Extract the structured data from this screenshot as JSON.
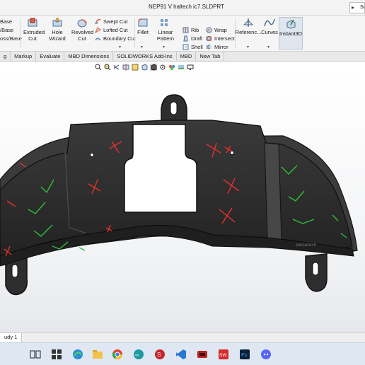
{
  "window": {
    "title": "NEP91 V haltech ic7.SLDPRT",
    "search_text": "Se"
  },
  "ribbon": {
    "left_items": [
      "Base",
      "/Base",
      "oss/Base"
    ],
    "extruded_cut": "Extruded Cut",
    "hole_wizard": "Hole Wizard",
    "revolved_cut": "Revolved Cut",
    "swept_cut": "Swept Cut",
    "lofted_cut": "Lofted Cut",
    "boundary_cut": "Boundary Cut",
    "fillet": "Fillet",
    "linear_pattern": "Linear Pattern",
    "rib": "Rib",
    "draft": "Draft",
    "shell": "Shell",
    "wrap": "Wrap",
    "intersect": "Intersect",
    "mirror": "Mirror",
    "reference": "Referenc...",
    "curves": "Curves",
    "instant3d": "Instant3D"
  },
  "tabs": [
    "g",
    "Markup",
    "Evaluate",
    "MBD Dimensions",
    "SOLIDWORKS Add-Ins",
    "MBD",
    "New Tab"
  ],
  "model": {
    "engraving": "swisatech",
    "body_color": "#2b2b2b",
    "red_mark": "#e8302b",
    "green_mark": "#2fbf3a"
  },
  "study_tab": "udy 1",
  "taskbar": {
    "background": "#dfe7f2"
  }
}
